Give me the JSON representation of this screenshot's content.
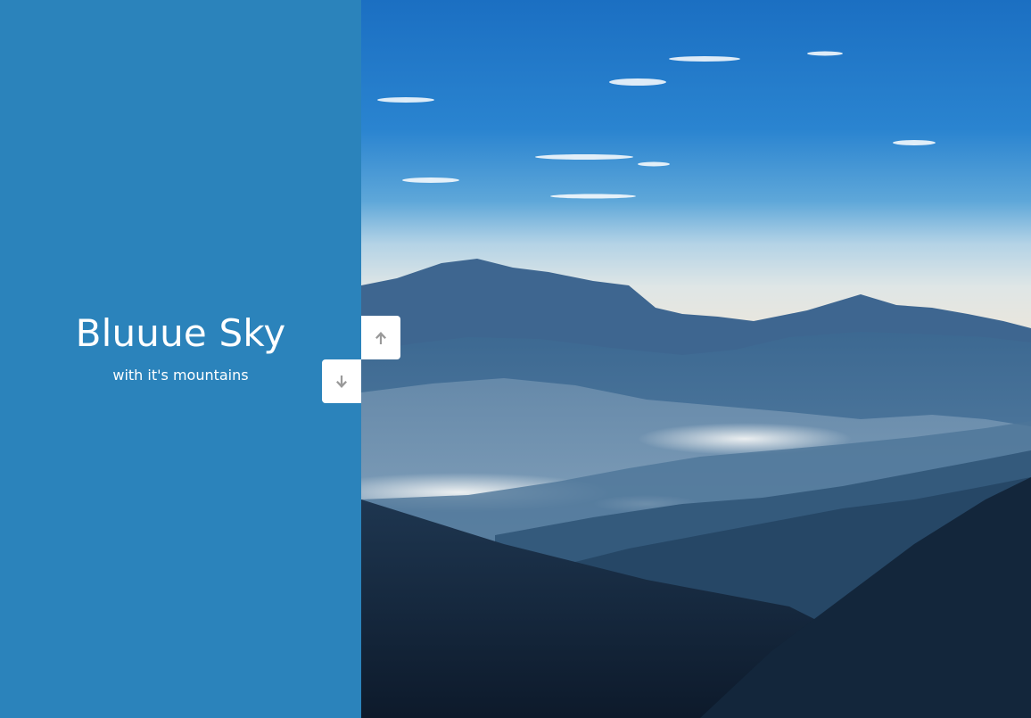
{
  "slide": {
    "title": "Bluuue Sky",
    "subtitle": "with it's mountains"
  },
  "colors": {
    "left_panel_bg": "#2b83bb",
    "button_bg": "#ffffff",
    "arrow_color": "#9a9a9a"
  },
  "controls": {
    "up_icon": "arrow-up-icon",
    "down_icon": "arrow-down-icon"
  },
  "image": {
    "subject": "mountain-landscape-photo"
  }
}
